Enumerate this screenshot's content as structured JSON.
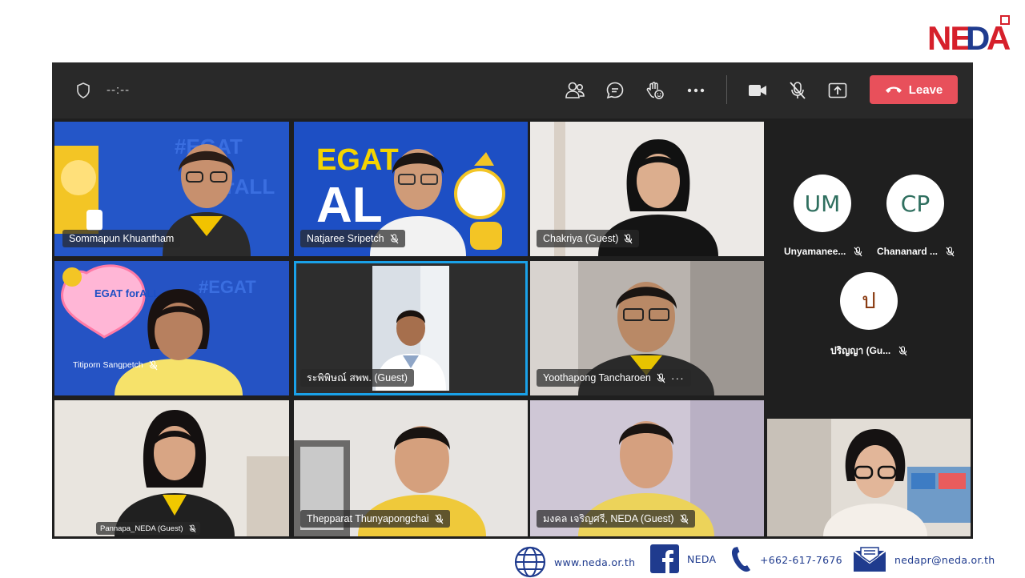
{
  "logo": {
    "text": "NEDA"
  },
  "toolbar": {
    "timer": "--:--",
    "leave_label": "Leave",
    "buttons": [
      "people-icon",
      "chat-icon",
      "raise-hand-icon",
      "more-icon",
      "camera-icon",
      "mic-off-icon",
      "share-icon"
    ]
  },
  "participants": [
    {
      "name": "Sommapun Khuantham"
    },
    {
      "name": "Natjaree Sripetch"
    },
    {
      "name": "Chakriya (Guest)"
    },
    {
      "name": "Titiporn Sangpetch"
    },
    {
      "name": "ระพิพิษณ์ สพพ. (Guest)"
    },
    {
      "name": "Yoothapong Tancharoen"
    },
    {
      "name": "Pannapa_NEDA (Guest)"
    },
    {
      "name": "Thepparat Thunyapongchai"
    },
    {
      "name": "มงคล เจริญศรี, NEDA (Guest)"
    }
  ],
  "roster": [
    {
      "initials": "UM",
      "name": "Unyamanee..."
    },
    {
      "initials": "CP",
      "name": "Chananard ..."
    },
    {
      "initials": "ป",
      "name": "ปริญญา (Gu..."
    }
  ],
  "footer": {
    "website": "www.neda.or.th",
    "facebook": "NEDA",
    "phone": "+662-617-7676",
    "email": "nedapr@neda.or.th"
  },
  "colors": {
    "leave": "#e8505b",
    "selected_border": "#1aa1e8",
    "brand_blue": "#1f3b8e",
    "brand_red": "#d6202b"
  }
}
